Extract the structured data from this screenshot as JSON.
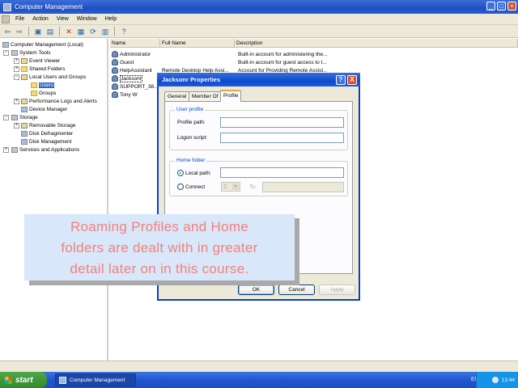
{
  "window": {
    "title": "Computer Management",
    "min": "_",
    "max": "□",
    "close": "×"
  },
  "menu": [
    "File",
    "Action",
    "View",
    "Window",
    "Help"
  ],
  "tree": {
    "root": "Computer Management (Local)",
    "system_tools": "System Tools",
    "event_viewer": "Event Viewer",
    "shared_folders": "Shared Folders",
    "local_users_groups": "Local Users and Groups",
    "users": "Users",
    "groups": "Groups",
    "performance_logs": "Performance Logs and Alerts",
    "device_manager": "Device Manager",
    "storage": "Storage",
    "removable_storage": "Removable Storage",
    "disk_defrag": "Disk Defragmenter",
    "disk_management": "Disk Management",
    "services_apps": "Services and Applications"
  },
  "list": {
    "headers": {
      "name": "Name",
      "full_name": "Full Name",
      "description": "Description"
    },
    "rows": [
      {
        "name": "Administrator",
        "full_name": "",
        "description": "Built-in account for administering the..."
      },
      {
        "name": "Guest",
        "full_name": "",
        "description": "Built-in account for guest access to t..."
      },
      {
        "name": "HelpAssistant",
        "full_name": "Remote Desktop Help Assi...",
        "description": "Account for Providing Remote Assist..."
      },
      {
        "name": "Jacksonr",
        "full_name": "",
        "description": ""
      },
      {
        "name": "SUPPORT_38...",
        "full_name": "",
        "description": ""
      },
      {
        "name": "Tony W",
        "full_name": "",
        "description": ""
      }
    ]
  },
  "dialog": {
    "title": "Jacksonr Properties",
    "help_btn": "?",
    "close_btn": "X",
    "tabs": [
      "General",
      "Member Of",
      "Profile"
    ],
    "user_profile_group": "User profile",
    "profile_path_label": "Profile path:",
    "profile_path_value": "",
    "logon_script_label": "Logon script:",
    "logon_script_value": "",
    "home_folder_group": "Home folder",
    "local_path_label": "Local path:",
    "local_path_value": "",
    "connect_label": "Connect",
    "drive_value": "Z:",
    "to_label": "To:",
    "connect_to_value": "",
    "ok": "OK",
    "cancel": "Cancel",
    "apply": "Apply"
  },
  "caption": {
    "line1": "Roaming Profiles and Home",
    "line2": "folders are dealt with in greater",
    "line3": "detail later on in this course."
  },
  "taskbar": {
    "start": "start",
    "task": "Computer Management",
    "lang": "EN",
    "clock": "13:44"
  },
  "colors": {
    "titlebar": "#2458d0",
    "caption_bg": "#d8e7f9",
    "caption_text": "#f5807a",
    "taskbar": "#2157d0",
    "start": "#3c9a38"
  }
}
